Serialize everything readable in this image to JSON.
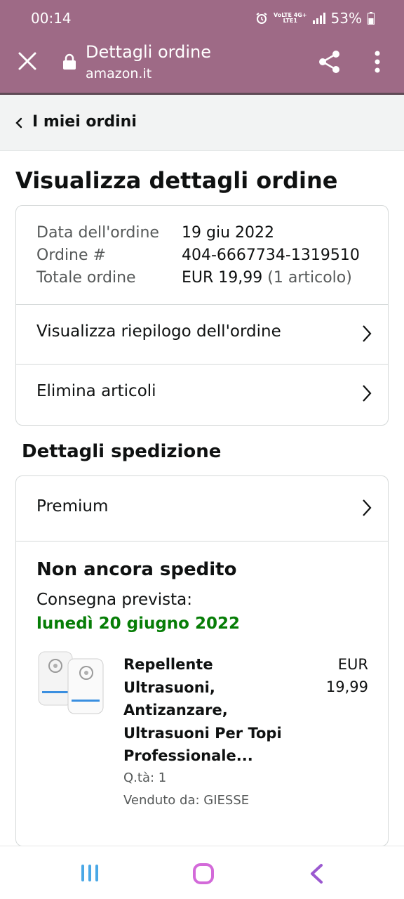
{
  "status_bar": {
    "time": "00:14",
    "battery": "53%",
    "network_top": "VoLTE 4G+",
    "network_bottom": "LTE1"
  },
  "browser": {
    "title": "Dettagli ordine",
    "domain": "amazon.it"
  },
  "breadcrumb": {
    "label": "I miei ordini"
  },
  "page": {
    "title": "Visualizza dettagli ordine"
  },
  "order": {
    "date_label": "Data dell'ordine",
    "date_value": "19 giu 2022",
    "number_label": "Ordine #",
    "number_value": "404-6667734-1319510",
    "total_label": "Totale ordine",
    "total_value": "EUR 19,99",
    "total_items": "(1 articolo)"
  },
  "links": {
    "summary": "Visualizza riepilogo dell'ordine",
    "delete": "Elimina articoli"
  },
  "shipping": {
    "section_title": "Dettagli spedizione",
    "method": "Premium",
    "status": "Non ancora spedito",
    "delivery_label": "Consegna prevista:",
    "delivery_date": "lunedì 20 giugno 2022"
  },
  "item": {
    "title_lines": [
      "Repellente",
      "Ultrasuoni,",
      "Antizanzare,",
      "Ultrasuoni Per Topi",
      "Professionale..."
    ],
    "price_lines": [
      "EUR",
      "19,99"
    ],
    "qty": "Q.tà: 1",
    "seller": "Venduto da: GIESSE"
  },
  "colors": {
    "app_bar": "#9e6a86",
    "delivery_green": "#067d06",
    "nav_home": "#d36ad9",
    "nav_recent": "#4aa8e6",
    "nav_back": "#9b59d0"
  }
}
